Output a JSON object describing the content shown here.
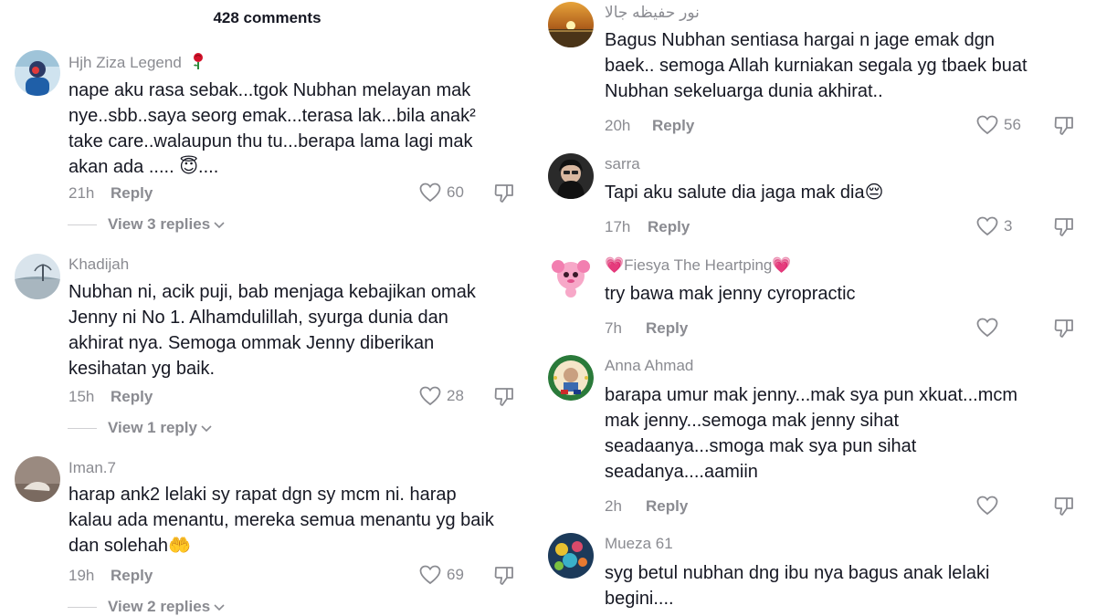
{
  "header": {
    "comment_count": "428 comments"
  },
  "left": [
    {
      "username": "Hjh Ziza Legend",
      "username_emoji": "rose",
      "lines": [
        "nape aku rasa sebak...tgok Nubhan melayan mak",
        "nye..sbb..saya seorg emak...terasa lak...bila anak²",
        "take care..walaupun thu tu...berapa lama lagi mak",
        "akan ada ..... 😇...."
      ],
      "time": "21h",
      "reply": "Reply",
      "likes": "60",
      "view_replies": "View 3 replies"
    },
    {
      "username": "Khadijah",
      "lines": [
        "Nubhan ni, acik puji, bab menjaga kebajikan omak",
        "Jenny ni No 1. Alhamdulillah, syurga dunia dan",
        "akhirat nya. Semoga ommak Jenny diberikan",
        "kesihatan yg baik."
      ],
      "time": "15h",
      "reply": "Reply",
      "likes": "28",
      "view_replies": "View 1 reply"
    },
    {
      "username": "Iman.7",
      "lines": [
        "harap ank2 lelaki sy rapat dgn sy mcm ni. harap",
        "kalau ada menantu, mereka semua menantu yg baik",
        "dan solehah🤲"
      ],
      "time": "19h",
      "reply": "Reply",
      "likes": "69",
      "view_replies": "View 2 replies"
    }
  ],
  "right": [
    {
      "username": "نور حفيظه جالا",
      "lines": [
        "Bagus Nubhan sentiasa hargai n jage emak dgn",
        "baek.. semoga Allah kurniakan segala yg tbaek buat",
        "Nubhan sekeluarga dunia akhirat.."
      ],
      "time": "20h",
      "reply": "Reply",
      "likes": "56"
    },
    {
      "username": "sarra",
      "lines": [
        "Tapi aku salute dia jaga mak dia😔"
      ],
      "time": "17h",
      "reply": "Reply",
      "likes": "3"
    },
    {
      "username": "💗Fiesya The Heartping💗",
      "lines": [
        "try bawa mak jenny cyropractic"
      ],
      "time": "7h",
      "reply": "Reply",
      "likes": ""
    },
    {
      "username": "Anna Ahmad",
      "lines": [
        "barapa umur mak jenny...mak sya pun xkuat...mcm",
        "mak jenny...semoga mak jenny sihat",
        "seadaanya...smoga mak sya pun sihat",
        "seadanya....aamiin"
      ],
      "time": "2h",
      "reply": "Reply",
      "likes": ""
    },
    {
      "username": "Mueza 61",
      "lines": [
        "syg betul nubhan dng ibu nya bagus anak lelaki",
        "begini...."
      ],
      "time": "",
      "reply": "",
      "likes": ""
    }
  ]
}
